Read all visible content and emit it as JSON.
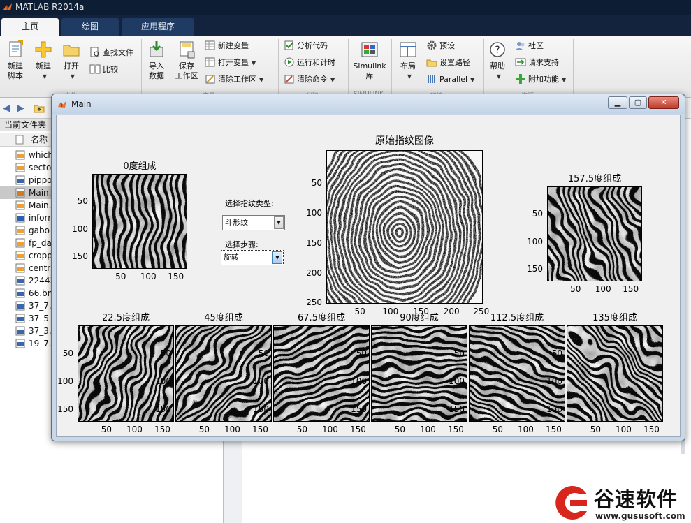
{
  "app": {
    "title": "MATLAB R2014a",
    "tabs": [
      "主页",
      "绘图",
      "应用程序"
    ]
  },
  "ribbon": {
    "new_script": "新建\n脚本",
    "new": "新建",
    "open": "打开",
    "find_files": "查找文件",
    "compare": "比较",
    "import": "导入\n数据",
    "save_ws": "保存\n工作区",
    "new_var": "新建变量",
    "open_var": "打开变量",
    "clear_ws": "清除工作区",
    "analyze": "分析代码",
    "run_time": "运行和计时",
    "clear_cmd": "清除命令",
    "simulink": "Simulink\n库",
    "layout": "布局",
    "prefs": "预设",
    "set_path": "设置路径",
    "parallel": "Parallel",
    "help": "帮助",
    "community": "社区",
    "request_support": "请求支持",
    "addons": "附加功能",
    "group_file": "文件",
    "group_var": "变量",
    "group_code": "代码",
    "group_simulink": "SIMULINK",
    "group_env": "环境",
    "group_res": "资源"
  },
  "file_browser": {
    "header": "当前文件夹",
    "column_name": "名称",
    "files": [
      "which",
      "secto",
      "pippo",
      "Main.",
      "Main.",
      "inforr",
      "gabo",
      "fp_da",
      "cropp",
      "centra",
      "22443",
      "66.bn",
      "37_7.b",
      "37_5_",
      "37_3.b",
      "19_7.b"
    ],
    "file_types": [
      "m",
      "m",
      "bmp",
      "fig",
      "m",
      "doc",
      "m",
      "m",
      "m",
      "m",
      "bmp",
      "bmp",
      "bmp",
      "bmp",
      "bmp",
      "bmp"
    ],
    "selected_index": 3
  },
  "figure": {
    "title": "Main",
    "select_type_label": "选择指纹类型:",
    "select_type_value": "斗形纹",
    "select_step_label": "选择步骤:",
    "select_step_value": "旋转",
    "original_title": "原始指纹图像",
    "original_xticks": [
      "50",
      "100",
      "150",
      "200",
      "250"
    ],
    "original_yticks": [
      "50",
      "100",
      "150",
      "200",
      "250"
    ],
    "small_ticks": [
      "50",
      "100",
      "150"
    ],
    "axes": [
      {
        "title": "0度组成",
        "angle": 0
      },
      {
        "title": "157.5度组成",
        "angle": 157.5
      },
      {
        "title": "22.5度组成",
        "angle": 22.5
      },
      {
        "title": "45度组成",
        "angle": 45
      },
      {
        "title": "67.5度组成",
        "angle": 67.5
      },
      {
        "title": "90度组成",
        "angle": 90
      },
      {
        "title": "112.5度组成",
        "angle": 112.5
      },
      {
        "title": "135度组成",
        "angle": 135
      }
    ]
  },
  "watermark": {
    "brand": "谷速软件",
    "url": "www.gususoft.com"
  }
}
